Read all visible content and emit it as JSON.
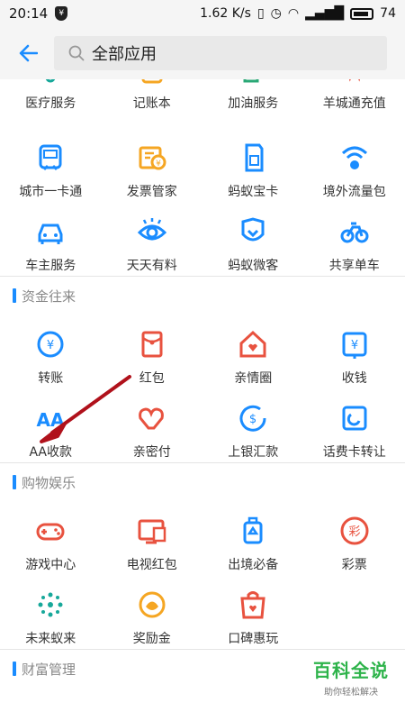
{
  "status": {
    "time": "20:14",
    "speed": "1.62 K/s",
    "battery": "74"
  },
  "header": {
    "title": "全部应用"
  },
  "groups": [
    {
      "items": [
        {
          "label": "医疗服务",
          "icon": "medical-icon"
        },
        {
          "label": "记账本",
          "icon": "ledger-icon"
        },
        {
          "label": "加油服务",
          "icon": "fuel-icon"
        },
        {
          "label": "羊城通充值",
          "icon": "yangchengtong-icon"
        },
        {
          "label": "城市一卡通",
          "icon": "city-card-icon"
        },
        {
          "label": "发票管家",
          "icon": "invoice-icon"
        },
        {
          "label": "蚂蚁宝卡",
          "icon": "sim-card-icon"
        },
        {
          "label": "境外流量包",
          "icon": "global-data-icon"
        },
        {
          "label": "车主服务",
          "icon": "car-icon"
        },
        {
          "label": "天天有料",
          "icon": "eye-icon"
        },
        {
          "label": "蚂蚁微客",
          "icon": "weike-icon"
        },
        {
          "label": "共享单车",
          "icon": "bike-icon"
        }
      ]
    },
    {
      "title": "资金往来",
      "items": [
        {
          "label": "转账",
          "icon": "transfer-icon"
        },
        {
          "label": "红包",
          "icon": "red-packet-icon"
        },
        {
          "label": "亲情圈",
          "icon": "family-icon"
        },
        {
          "label": "收钱",
          "icon": "receive-money-icon"
        },
        {
          "label": "AA收款",
          "icon": "aa-icon"
        },
        {
          "label": "亲密付",
          "icon": "intimate-pay-icon"
        },
        {
          "label": "上银汇款",
          "icon": "remittance-icon"
        },
        {
          "label": "话费卡转让",
          "icon": "phone-card-icon"
        }
      ]
    },
    {
      "title": "购物娱乐",
      "items": [
        {
          "label": "游戏中心",
          "icon": "game-icon"
        },
        {
          "label": "电视红包",
          "icon": "tv-icon"
        },
        {
          "label": "出境必备",
          "icon": "luggage-icon"
        },
        {
          "label": "彩票",
          "icon": "lottery-icon"
        },
        {
          "label": "未来蚁来",
          "icon": "future-icon"
        },
        {
          "label": "奖励金",
          "icon": "reward-icon"
        },
        {
          "label": "口碑惠玩",
          "icon": "koubei-icon"
        }
      ]
    },
    {
      "title": "财富管理"
    }
  ],
  "watermark": {
    "big": "百科全说",
    "small": "助你轻松解决"
  },
  "colors": {
    "blue": "#1a8cff",
    "orange": "#f5a623",
    "green": "#2aa876",
    "red": "#e8523f",
    "teal": "#17a89a"
  }
}
